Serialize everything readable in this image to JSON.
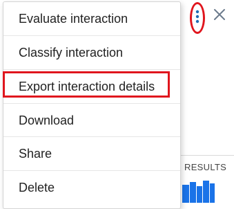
{
  "menu": {
    "items": [
      {
        "label": "Evaluate interaction"
      },
      {
        "label": "Classify interaction"
      },
      {
        "label": "Export interaction details",
        "highlighted": true
      },
      {
        "label": "Download"
      },
      {
        "label": "Share"
      },
      {
        "label": "Delete"
      }
    ]
  },
  "header": {
    "more_options_icon": "vertical-ellipsis-icon",
    "close_icon": "close-icon"
  },
  "background": {
    "results_tab_label": "RESULTS"
  },
  "colors": {
    "annotation_red": "#e0151d",
    "icon_blue": "#1f6fb5",
    "icon_gray": "#6b7b8c",
    "chart_blue": "#1a73e8",
    "text": "#222222"
  }
}
